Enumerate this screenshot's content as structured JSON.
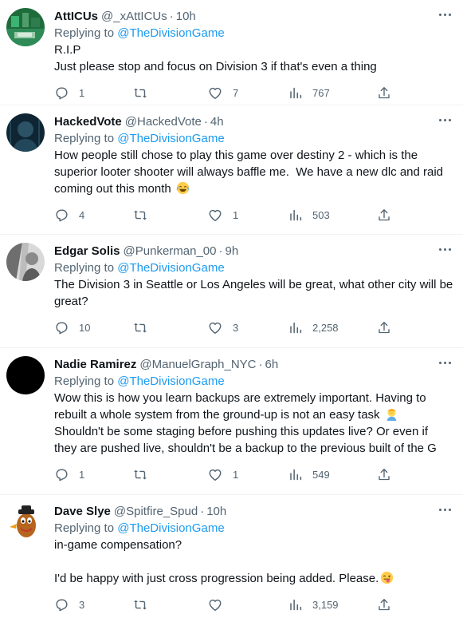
{
  "tweets": [
    {
      "name": "AttICUs",
      "handle": "@_xAttICUs",
      "sep": "·",
      "time": "10h",
      "replying_prefix": "Replying to ",
      "replying_to": "@TheDivisionGame",
      "text": "R.I.P\nJust please stop and focus on Division 3 if that's even a thing",
      "emoji": "",
      "replies": "1",
      "retweets": "",
      "likes": "7",
      "views": "767",
      "avatar_color": "#2e8b57"
    },
    {
      "name": "HackedVote",
      "handle": "@HackedVote",
      "sep": "·",
      "time": "4h",
      "replying_prefix": "Replying to ",
      "replying_to": "@TheDivisionGame",
      "text": "How people still chose to play this game over destiny 2 - which is the superior looter shooter will always baffle me.  We have a new dlc and raid coming out this month ",
      "emoji": "joy-emoji",
      "replies": "4",
      "retweets": "",
      "likes": "1",
      "views": "503",
      "avatar_color": "#1f3b4d"
    },
    {
      "name": "Edgar Solis",
      "handle": "@Punkerman_00",
      "sep": "·",
      "time": "9h",
      "replying_prefix": "Replying to ",
      "replying_to": "@TheDivisionGame",
      "text": "The Division 3 in Seattle or Los Angeles will be great, what other city will be great?",
      "emoji": "",
      "replies": "10",
      "retweets": "",
      "likes": "3",
      "views": "2,258",
      "avatar_color": "#9a9a9a"
    },
    {
      "name": "Nadie Ramirez",
      "handle": "@ManuelGraph_NYC",
      "sep": "·",
      "time": "6h",
      "replying_prefix": "Replying to ",
      "replying_to": "@TheDivisionGame",
      "text": "Wow this is how you learn backups are extremely important. Having to rebuilt a whole system from the ground-up is not an easy task ",
      "text2": "\nShouldn't be some staging before pushing this updates live? Or even if they are pushed live, shouldn't be a backup to the previous built of the G",
      "emoji": "person-facepalming-emoji",
      "replies": "1",
      "retweets": "",
      "likes": "1",
      "views": "549",
      "avatar_color": "#000000"
    },
    {
      "name": "Dave Slye",
      "handle": "@Spitfire_Spud",
      "sep": "·",
      "time": "10h",
      "replying_prefix": "Replying to ",
      "replying_to": "@TheDivisionGame",
      "text": "in-game compensation?\n\nI'd be happy with just cross progression being added. Please.",
      "emoji": "winking-tongue-emoji",
      "replies": "3",
      "retweets": "",
      "likes": "",
      "views": "3,159",
      "avatar_color": "#b5651d"
    }
  ],
  "colors": {
    "link": "#1d9bf0",
    "secondary_text": "#536471",
    "primary_text": "#0f1419",
    "divider": "#eff3f4"
  }
}
